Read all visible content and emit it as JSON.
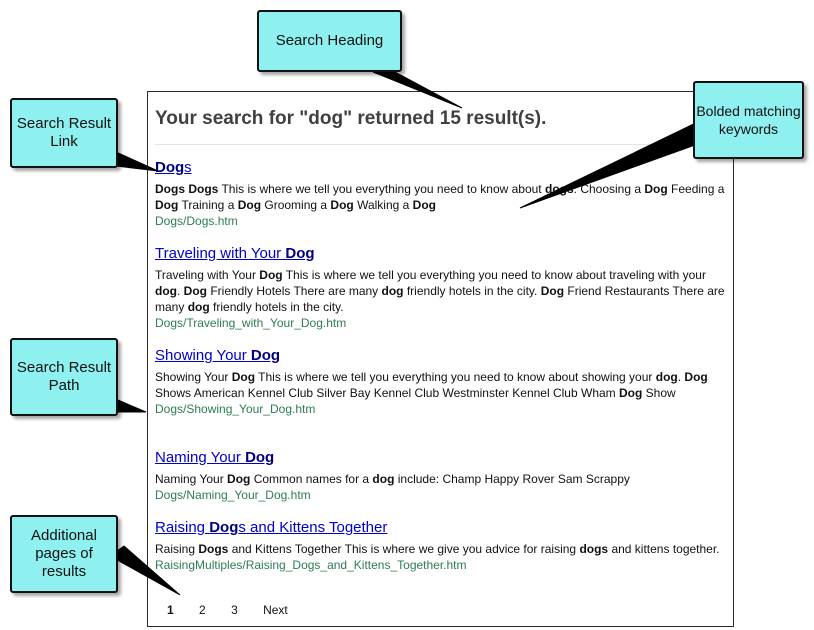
{
  "search": {
    "heading": "Your search for \"dog\" returned 15 result(s).",
    "results": [
      {
        "title": [
          {
            "t": "Dog",
            "b": true
          },
          {
            "t": "s",
            "b": false
          }
        ],
        "snippet": [
          {
            "t": "Dogs Dogs",
            "b": true
          },
          {
            "t": " This is where we tell you everything you need to know about ",
            "b": false
          },
          {
            "t": "dogs",
            "b": true
          },
          {
            "t": ": Choosing a ",
            "b": false
          },
          {
            "t": "Dog",
            "b": true
          },
          {
            "t": " Feeding a ",
            "b": false
          },
          {
            "t": "Dog",
            "b": true
          },
          {
            "t": " Training a ",
            "b": false
          },
          {
            "t": "Dog",
            "b": true
          },
          {
            "t": " Grooming a ",
            "b": false
          },
          {
            "t": "Dog",
            "b": true
          },
          {
            "t": " Walking a ",
            "b": false
          },
          {
            "t": "Dog",
            "b": true
          }
        ],
        "path": "Dogs/Dogs.htm"
      },
      {
        "title": [
          {
            "t": "Traveling with Your ",
            "b": false
          },
          {
            "t": "Dog",
            "b": true
          }
        ],
        "snippet": [
          {
            "t": "Traveling with Your ",
            "b": false
          },
          {
            "t": "Dog",
            "b": true
          },
          {
            "t": " This is where we tell you everything you need to know about traveling with your ",
            "b": false
          },
          {
            "t": "dog",
            "b": true
          },
          {
            "t": ". ",
            "b": false
          },
          {
            "t": "Dog",
            "b": true
          },
          {
            "t": " Friendly Hotels There are many ",
            "b": false
          },
          {
            "t": "dog",
            "b": true
          },
          {
            "t": " friendly hotels in the city. ",
            "b": false
          },
          {
            "t": "Dog",
            "b": true
          },
          {
            "t": " Friend Restaurants There are many ",
            "b": false
          },
          {
            "t": "dog",
            "b": true
          },
          {
            "t": " friendly hotels in the city.",
            "b": false
          }
        ],
        "path": "Dogs/Traveling_with_Your_Dog.htm"
      },
      {
        "title": [
          {
            "t": "Showing Your ",
            "b": false
          },
          {
            "t": "Dog",
            "b": true
          }
        ],
        "snippet": [
          {
            "t": "Showing Your ",
            "b": false
          },
          {
            "t": "Dog",
            "b": true
          },
          {
            "t": " This is where we tell you everything you need to know about showing your ",
            "b": false
          },
          {
            "t": "dog",
            "b": true
          },
          {
            "t": ". ",
            "b": false
          },
          {
            "t": "Dog",
            "b": true
          },
          {
            "t": " Shows American Kennel Club Silver Bay Kennel Club Westminster Kennel Club Wham ",
            "b": false
          },
          {
            "t": "Dog",
            "b": true
          },
          {
            "t": " Show",
            "b": false
          }
        ],
        "path": "Dogs/Showing_Your_Dog.htm"
      },
      {
        "title": [
          {
            "t": "Naming Your ",
            "b": false
          },
          {
            "t": "Dog",
            "b": true
          }
        ],
        "snippet": [
          {
            "t": "Naming Your ",
            "b": false
          },
          {
            "t": "Dog",
            "b": true
          },
          {
            "t": " Common names for a ",
            "b": false
          },
          {
            "t": "dog",
            "b": true
          },
          {
            "t": " include: Champ Happy Rover Sam Scrappy",
            "b": false
          }
        ],
        "path": "Dogs/Naming_Your_Dog.htm"
      },
      {
        "title": [
          {
            "t": "Raising ",
            "b": false
          },
          {
            "t": "Dog",
            "b": true
          },
          {
            "t": "s and Kittens Together",
            "b": false
          }
        ],
        "snippet": [
          {
            "t": "Raising ",
            "b": false
          },
          {
            "t": "Dogs",
            "b": true
          },
          {
            "t": " and Kittens Together This is where we give you advice for raising ",
            "b": false
          },
          {
            "t": "dogs",
            "b": true
          },
          {
            "t": " and kittens together.",
            "b": false
          }
        ],
        "path": "RaisingMultiples/Raising_Dogs_and_Kittens_Together.htm"
      }
    ],
    "pager": {
      "pages": [
        "1",
        "2",
        "3"
      ],
      "current": "1",
      "next_label": "Next"
    }
  },
  "callouts": {
    "search_heading": "Search Heading",
    "bolded_keywords": "Bolded matching keywords",
    "result_link": "Search Result Link",
    "result_path": "Search Result Path",
    "additional_pages": "Additional pages of results"
  },
  "colors": {
    "callout_fill": "#8ff0f0",
    "link": "#0000cc",
    "path": "#2e7d4f"
  }
}
